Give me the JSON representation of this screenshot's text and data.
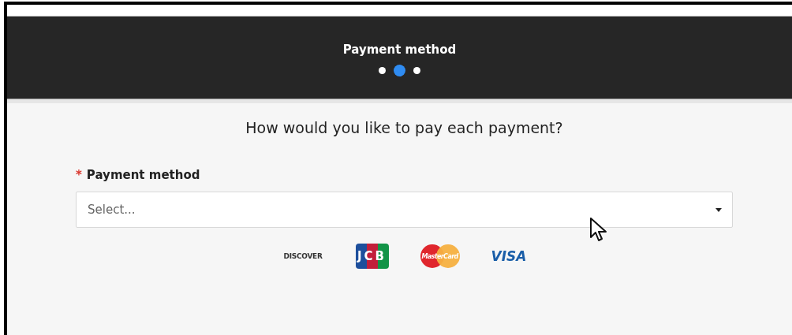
{
  "header": {
    "title": "Payment method",
    "steps": [
      {
        "selected": false
      },
      {
        "selected": true
      },
      {
        "selected": false
      }
    ]
  },
  "question": "How would you like to pay each payment?",
  "payment_method": {
    "required_mark": "*",
    "label": "Payment method",
    "placeholder": "Select..."
  },
  "card_logos": [
    {
      "kind": "discover",
      "label": "DISCOVER"
    },
    {
      "kind": "jcb",
      "label": "JCB"
    },
    {
      "kind": "mastercard",
      "label": "MasterCard"
    },
    {
      "kind": "visa",
      "label": "VISA"
    }
  ]
}
